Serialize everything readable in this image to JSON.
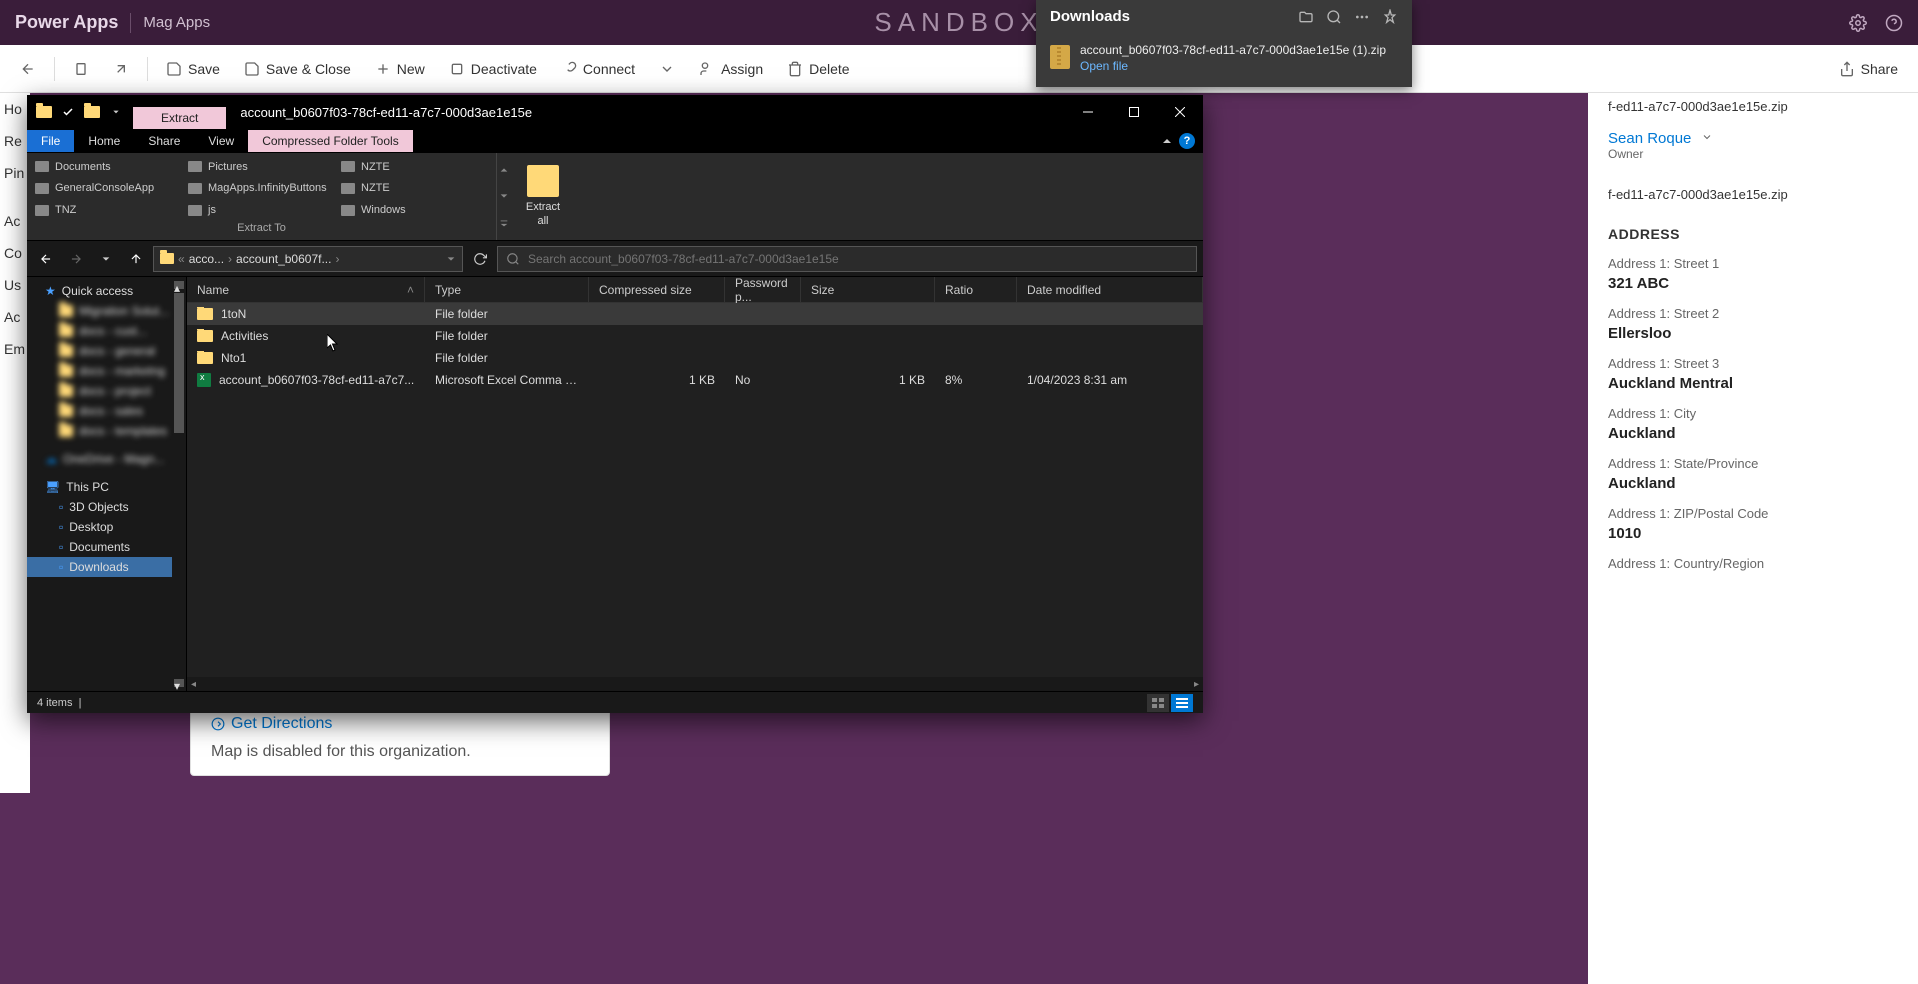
{
  "powerapps": {
    "logo": "Power Apps",
    "app_name": "Mag Apps",
    "watermark": "SANDBOX"
  },
  "toolbar": {
    "back": "",
    "save": "Save",
    "save_close": "Save & Close",
    "new": "New",
    "deactivate": "Deactivate",
    "connect": "Connect",
    "assign": "Assign",
    "delete": "Delete",
    "share": "Share"
  },
  "leftnav": {
    "items": [
      "Ho",
      "Re",
      "Pin",
      "Ac",
      "Co",
      "Us",
      "Ac",
      "Em"
    ]
  },
  "map_card": {
    "gd": "Get Directions",
    "msg": "Map is disabled for this organization."
  },
  "details": {
    "zip1": "f-ed11-a7c7-000d3ae1e15e.zip",
    "zip2": "f-ed11-a7c7-000d3ae1e15e.zip",
    "owner_name": "Sean Roque",
    "owner_role": "Owner",
    "section": "ADDRESS",
    "fields": [
      {
        "label": "Address 1: Street 1",
        "value": "321 ABC"
      },
      {
        "label": "Address 1: Street 2",
        "value": "Ellersloo"
      },
      {
        "label": "Address 1: Street 3",
        "value": "Auckland Mentral"
      },
      {
        "label": "Address 1: City",
        "value": "Auckland"
      },
      {
        "label": "Address 1: State/Province",
        "value": "Auckland"
      },
      {
        "label": "Address 1: ZIP/Postal Code",
        "value": "1010"
      },
      {
        "label": "Address 1: Country/Region",
        "value": ""
      }
    ]
  },
  "downloads": {
    "title": "Downloads",
    "filename": "account_b0607f03-78cf-ed11-a7c7-000d3ae1e15e (1).zip",
    "open": "Open file"
  },
  "explorer": {
    "context_tab": "Extract",
    "context_group": "Compressed Folder Tools",
    "title": "account_b0607f03-78cf-ed11-a7c7-000d3ae1e15e",
    "ribbon_tabs": {
      "file": "File",
      "home": "Home",
      "share": "Share",
      "view": "View"
    },
    "ribbon": {
      "destinations": [
        "Documents",
        "Pictures",
        "NZTE",
        "GeneralConsoleApp",
        "MagApps.InfinityButtons",
        "NZTE",
        "TNZ",
        "js",
        "Windows"
      ],
      "extract_to": "Extract To",
      "extract_all": "Extract all"
    },
    "breadcrumb": {
      "p1": "acco...",
      "p2": "account_b0607f..."
    },
    "search_placeholder": "Search account_b0607f03-78cf-ed11-a7c7-000d3ae1e15e",
    "columns": {
      "name": "Name",
      "type": "Type",
      "compressed": "Compressed size",
      "password": "Password p...",
      "size": "Size",
      "ratio": "Ratio",
      "date": "Date modified"
    },
    "rows": [
      {
        "name": "1toN",
        "type": "File folder",
        "comp": "",
        "pass": "",
        "size": "",
        "ratio": "",
        "date": ""
      },
      {
        "name": "Activities",
        "type": "File folder",
        "comp": "",
        "pass": "",
        "size": "",
        "ratio": "",
        "date": ""
      },
      {
        "name": "Nto1",
        "type": "File folder",
        "comp": "",
        "pass": "",
        "size": "",
        "ratio": "",
        "date": ""
      },
      {
        "name": "account_b0607f03-78cf-ed11-a7c7...",
        "type": "Microsoft Excel Comma S...",
        "comp": "1 KB",
        "pass": "No",
        "size": "1 KB",
        "ratio": "8%",
        "date": "1/04/2023 8:31 am"
      }
    ],
    "tree": {
      "quick_access": "Quick access",
      "onedrive": "OneDrive - Magn...",
      "this_pc": "This PC",
      "pc_children": [
        "3D Objects",
        "Desktop",
        "Documents",
        "Downloads"
      ]
    },
    "status": "4 items"
  }
}
